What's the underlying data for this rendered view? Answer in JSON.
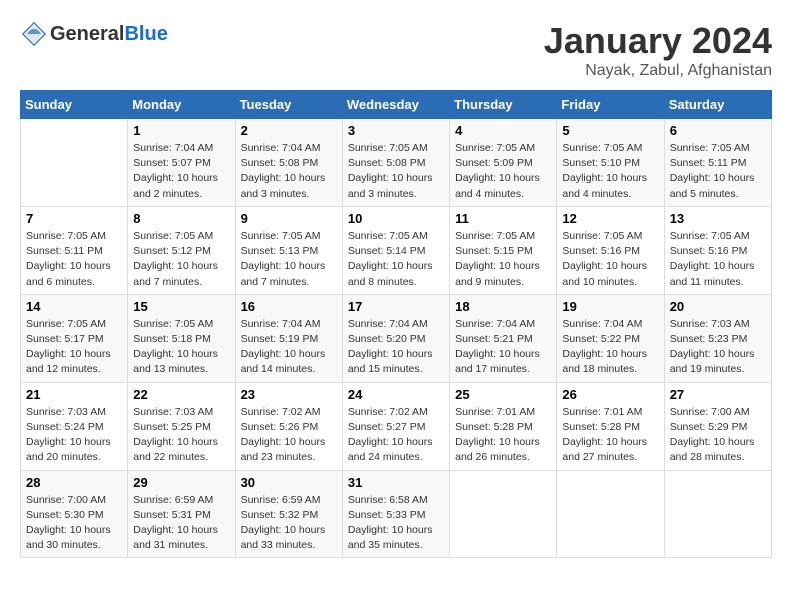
{
  "header": {
    "logo_line1": "General",
    "logo_line2": "Blue",
    "month": "January 2024",
    "location": "Nayak, Zabul, Afghanistan"
  },
  "weekdays": [
    "Sunday",
    "Monday",
    "Tuesday",
    "Wednesday",
    "Thursday",
    "Friday",
    "Saturday"
  ],
  "weeks": [
    [
      {
        "day": "",
        "info": ""
      },
      {
        "day": "1",
        "info": "Sunrise: 7:04 AM\nSunset: 5:07 PM\nDaylight: 10 hours\nand 2 minutes."
      },
      {
        "day": "2",
        "info": "Sunrise: 7:04 AM\nSunset: 5:08 PM\nDaylight: 10 hours\nand 3 minutes."
      },
      {
        "day": "3",
        "info": "Sunrise: 7:05 AM\nSunset: 5:08 PM\nDaylight: 10 hours\nand 3 minutes."
      },
      {
        "day": "4",
        "info": "Sunrise: 7:05 AM\nSunset: 5:09 PM\nDaylight: 10 hours\nand 4 minutes."
      },
      {
        "day": "5",
        "info": "Sunrise: 7:05 AM\nSunset: 5:10 PM\nDaylight: 10 hours\nand 4 minutes."
      },
      {
        "day": "6",
        "info": "Sunrise: 7:05 AM\nSunset: 5:11 PM\nDaylight: 10 hours\nand 5 minutes."
      }
    ],
    [
      {
        "day": "7",
        "info": "Sunrise: 7:05 AM\nSunset: 5:11 PM\nDaylight: 10 hours\nand 6 minutes."
      },
      {
        "day": "8",
        "info": "Sunrise: 7:05 AM\nSunset: 5:12 PM\nDaylight: 10 hours\nand 7 minutes."
      },
      {
        "day": "9",
        "info": "Sunrise: 7:05 AM\nSunset: 5:13 PM\nDaylight: 10 hours\nand 7 minutes."
      },
      {
        "day": "10",
        "info": "Sunrise: 7:05 AM\nSunset: 5:14 PM\nDaylight: 10 hours\nand 8 minutes."
      },
      {
        "day": "11",
        "info": "Sunrise: 7:05 AM\nSunset: 5:15 PM\nDaylight: 10 hours\nand 9 minutes."
      },
      {
        "day": "12",
        "info": "Sunrise: 7:05 AM\nSunset: 5:16 PM\nDaylight: 10 hours\nand 10 minutes."
      },
      {
        "day": "13",
        "info": "Sunrise: 7:05 AM\nSunset: 5:16 PM\nDaylight: 10 hours\nand 11 minutes."
      }
    ],
    [
      {
        "day": "14",
        "info": "Sunrise: 7:05 AM\nSunset: 5:17 PM\nDaylight: 10 hours\nand 12 minutes."
      },
      {
        "day": "15",
        "info": "Sunrise: 7:05 AM\nSunset: 5:18 PM\nDaylight: 10 hours\nand 13 minutes."
      },
      {
        "day": "16",
        "info": "Sunrise: 7:04 AM\nSunset: 5:19 PM\nDaylight: 10 hours\nand 14 minutes."
      },
      {
        "day": "17",
        "info": "Sunrise: 7:04 AM\nSunset: 5:20 PM\nDaylight: 10 hours\nand 15 minutes."
      },
      {
        "day": "18",
        "info": "Sunrise: 7:04 AM\nSunset: 5:21 PM\nDaylight: 10 hours\nand 17 minutes."
      },
      {
        "day": "19",
        "info": "Sunrise: 7:04 AM\nSunset: 5:22 PM\nDaylight: 10 hours\nand 18 minutes."
      },
      {
        "day": "20",
        "info": "Sunrise: 7:03 AM\nSunset: 5:23 PM\nDaylight: 10 hours\nand 19 minutes."
      }
    ],
    [
      {
        "day": "21",
        "info": "Sunrise: 7:03 AM\nSunset: 5:24 PM\nDaylight: 10 hours\nand 20 minutes."
      },
      {
        "day": "22",
        "info": "Sunrise: 7:03 AM\nSunset: 5:25 PM\nDaylight: 10 hours\nand 22 minutes."
      },
      {
        "day": "23",
        "info": "Sunrise: 7:02 AM\nSunset: 5:26 PM\nDaylight: 10 hours\nand 23 minutes."
      },
      {
        "day": "24",
        "info": "Sunrise: 7:02 AM\nSunset: 5:27 PM\nDaylight: 10 hours\nand 24 minutes."
      },
      {
        "day": "25",
        "info": "Sunrise: 7:01 AM\nSunset: 5:28 PM\nDaylight: 10 hours\nand 26 minutes."
      },
      {
        "day": "26",
        "info": "Sunrise: 7:01 AM\nSunset: 5:28 PM\nDaylight: 10 hours\nand 27 minutes."
      },
      {
        "day": "27",
        "info": "Sunrise: 7:00 AM\nSunset: 5:29 PM\nDaylight: 10 hours\nand 28 minutes."
      }
    ],
    [
      {
        "day": "28",
        "info": "Sunrise: 7:00 AM\nSunset: 5:30 PM\nDaylight: 10 hours\nand 30 minutes."
      },
      {
        "day": "29",
        "info": "Sunrise: 6:59 AM\nSunset: 5:31 PM\nDaylight: 10 hours\nand 31 minutes."
      },
      {
        "day": "30",
        "info": "Sunrise: 6:59 AM\nSunset: 5:32 PM\nDaylight: 10 hours\nand 33 minutes."
      },
      {
        "day": "31",
        "info": "Sunrise: 6:58 AM\nSunset: 5:33 PM\nDaylight: 10 hours\nand 35 minutes."
      },
      {
        "day": "",
        "info": ""
      },
      {
        "day": "",
        "info": ""
      },
      {
        "day": "",
        "info": ""
      }
    ]
  ]
}
